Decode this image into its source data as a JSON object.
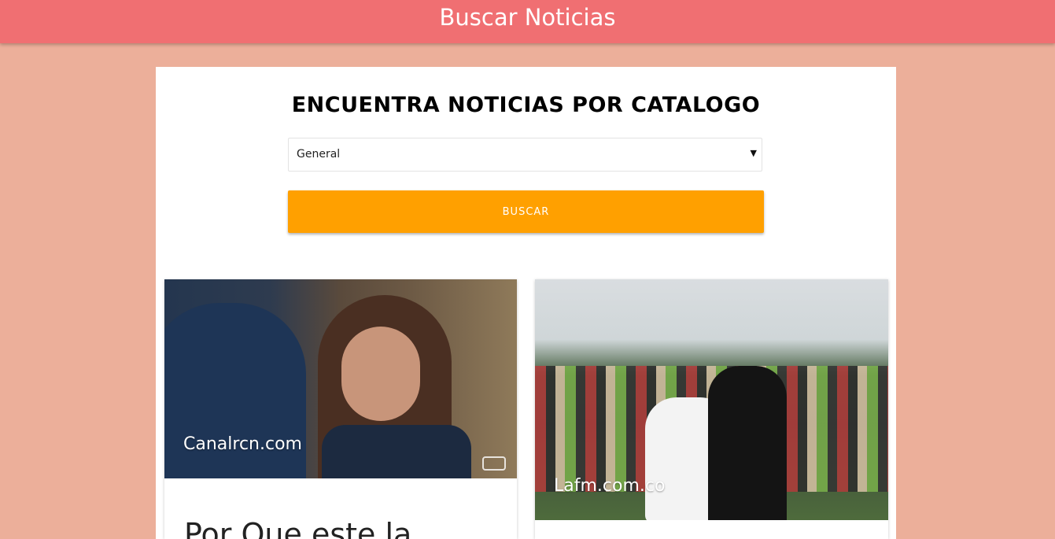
{
  "header": {
    "title": "Buscar Noticias"
  },
  "search": {
    "heading": "ENCUENTRA NOTICIAS POR CATALOGO",
    "category_selected": "General",
    "button_label": "BUSCAR"
  },
  "colors": {
    "header_bg": "#f06f72",
    "page_bg": "#ecaf9a",
    "button_bg": "#ffa000"
  },
  "news": [
    {
      "source": "Canalrcn.com",
      "title": "Por Que este la"
    },
    {
      "source": "Lafm.com.co"
    }
  ]
}
